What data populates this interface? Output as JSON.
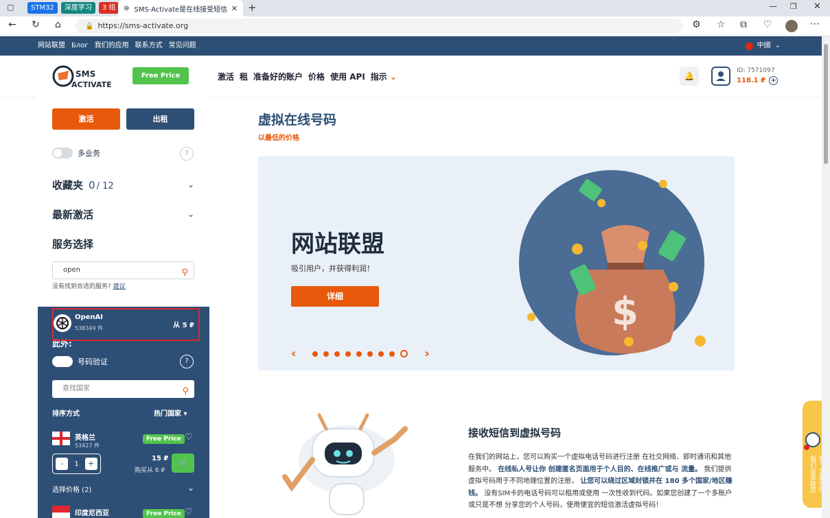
{
  "browser": {
    "tab_groups": [
      {
        "label": "STM32",
        "color": "#1a73e8"
      },
      {
        "label": "深度学习",
        "color": "#12877f"
      },
      {
        "label": "3 组",
        "color": "#d93025"
      }
    ],
    "active_tab_title": "SMS-Activate是在线接受短信的服",
    "url": "https://sms-activate.org"
  },
  "topbar": {
    "links": [
      "网站联盟",
      "Блог",
      "我们的应用",
      "联系方式",
      "常见问题"
    ],
    "language": "中國"
  },
  "header": {
    "logo_top": "SMS",
    "logo_bottom": "ACTIVATE",
    "free_price": "Free Price",
    "nav": [
      "激活",
      "租",
      "准备好的账户",
      "价格",
      "使用 API",
      "指示"
    ],
    "user_id": "ID: 7571097",
    "balance": "118.1 ₽"
  },
  "sidebar": {
    "activate_button": "激活",
    "rent_button": "出租",
    "multi_service_label": "多业务",
    "favorites_label": "收藏夹",
    "favorites_count": "0",
    "favorites_total": "/ 12",
    "recent_label": "最新激活",
    "service_select_label": "服务选择",
    "search_value": "open",
    "not_found_text": "没有找到合适的服务?",
    "suggest_link": "建议",
    "service": {
      "name": "OpenAI",
      "count": "538349 件",
      "price": "从 5 ₽"
    },
    "also_label": "此外:",
    "number_verify_label": "号码验证",
    "country_search_placeholder": "查找国家",
    "sort_label": "排序方式",
    "sort_value": "热门国家",
    "countries": [
      {
        "name": "英格兰",
        "count": "53427 件",
        "free_price": "Free Price",
        "price": "15 ₽",
        "buy_from": "购买从 6 ₽",
        "qty": "1"
      },
      {
        "name": "印度尼西亚",
        "free_price": "Free Price"
      }
    ],
    "select_price": "选择价格 (2)"
  },
  "main": {
    "title": "虚拟在线号码",
    "subtitle": "以最低的价格",
    "banner": {
      "title": "网站联盟",
      "desc": "吸引用户，并获得利润！",
      "button": "详细"
    },
    "section2": {
      "title": "接收短信到虚拟号码",
      "p1": "在我们的网站上，您可以购买一个虚拟电话号码进行注册 在社交网络、即时通讯和其他服务中。",
      "b1": "在线私人号让你 创建匿名页面用于个人目的、在线推广或与 流量。",
      "p2": "我们提供虚拟号码用于不同地理位置的注册，",
      "b2": "让您可以绕过区域封锁并在 180 多个国家/地区赚钱。",
      "p3": "没有SIM卡的电话号码可以租用或使用 一次性收到代码。如果您创建了一个多账户或只是不想 分享您的个人号码，使用便宜的短信激活虚拟号码！"
    }
  },
  "feedback": {
    "label": "留下您的反馈，我们会奖励您"
  }
}
